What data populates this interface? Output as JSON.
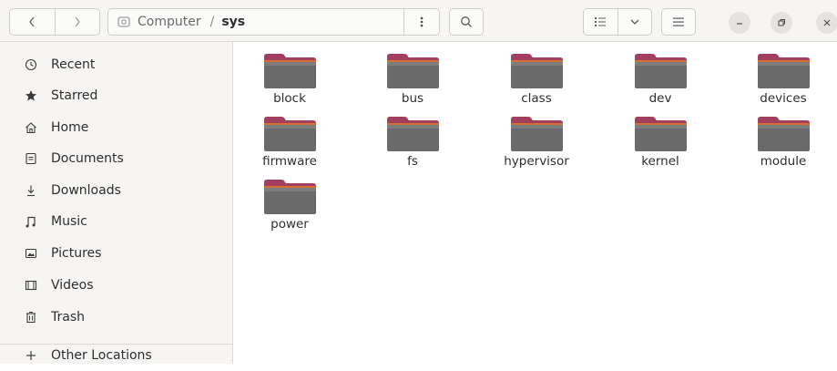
{
  "path": {
    "root_label": "Computer",
    "separator": "/",
    "current": "sys"
  },
  "sidebar": {
    "items": [
      {
        "label": "Recent",
        "icon": "clock-icon"
      },
      {
        "label": "Starred",
        "icon": "star-icon"
      },
      {
        "label": "Home",
        "icon": "home-icon"
      },
      {
        "label": "Documents",
        "icon": "document-icon"
      },
      {
        "label": "Downloads",
        "icon": "download-icon"
      },
      {
        "label": "Music",
        "icon": "music-icon"
      },
      {
        "label": "Pictures",
        "icon": "pictures-icon"
      },
      {
        "label": "Videos",
        "icon": "video-icon"
      },
      {
        "label": "Trash",
        "icon": "trash-icon"
      },
      {
        "label": "Other Locations",
        "icon": "plus-icon"
      }
    ]
  },
  "folders": [
    "block",
    "bus",
    "class",
    "dev",
    "devices",
    "firmware",
    "fs",
    "hypervisor",
    "kernel",
    "module",
    "power"
  ],
  "colors": {
    "folder_tab": "#a23f5f",
    "folder_front_top": "#7d7d7d",
    "folder_front_bottom": "#5f5f5f",
    "folder_accent": "#d36f34",
    "sidebar_bg": "#f6f5f4"
  }
}
